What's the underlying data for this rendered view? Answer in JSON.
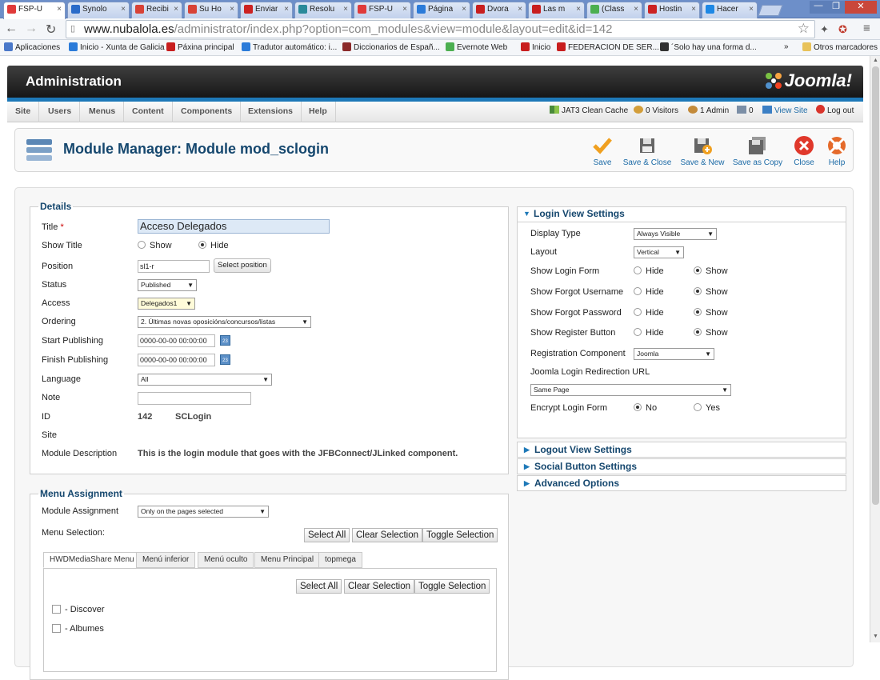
{
  "browser": {
    "tabs": [
      {
        "label": "FSP-U",
        "color": "#e03a3a"
      },
      {
        "label": "Synolo",
        "color": "#2a6bc9"
      },
      {
        "label": "Recibi",
        "color": "#d84236"
      },
      {
        "label": "Su Ho",
        "color": "#d84236"
      },
      {
        "label": "Enviar",
        "color": "#cc2222"
      },
      {
        "label": "Resolu",
        "color": "#2a8a9a"
      },
      {
        "label": "FSP-U",
        "color": "#e03a3a"
      },
      {
        "label": "Página",
        "color": "#2b7bd9"
      },
      {
        "label": "Dvora",
        "color": "#c81e1e"
      },
      {
        "label": "Las m",
        "color": "#c81e1e"
      },
      {
        "label": "(Class",
        "color": "#4caf50"
      },
      {
        "label": "Hostin",
        "color": "#cc2222"
      },
      {
        "label": "Hacer",
        "color": "#1e88e5"
      }
    ],
    "url_host": "www.nubalola.es",
    "url_path": "/administrator/index.php?option=com_modules&view=module&layout=edit&id=142",
    "bookmarks": [
      {
        "label": "Aplicaciones",
        "color": "#4a78c9"
      },
      {
        "label": "Inicio - Xunta de Galicia",
        "color": "#2b7bd9"
      },
      {
        "label": "Páxina principal",
        "color": "#c81e1e"
      },
      {
        "label": "Tradutor automático: i...",
        "color": "#2b7bd9"
      },
      {
        "label": "Diccionarios de Españ...",
        "color": "#8b2a2a"
      },
      {
        "label": "Evernote Web",
        "color": "#4caf50"
      },
      {
        "label": "Inicio",
        "color": "#c81e1e"
      },
      {
        "label": "FEDERACION DE SER...",
        "color": "#c81e1e"
      },
      {
        "label": "´Solo hay una forma d...",
        "color": "#333333"
      },
      {
        "label": "»",
        "color": "#00000000"
      },
      {
        "label": "Otros marcadores",
        "color": "#e8c25a"
      }
    ]
  },
  "header": {
    "title": "Administration",
    "logo_text": "Joomla!"
  },
  "menu": [
    "Site",
    "Users",
    "Menus",
    "Content",
    "Components",
    "Extensions",
    "Help"
  ],
  "status": {
    "cache": "JAT3 Clean Cache",
    "visitors": "0 Visitors",
    "admin": "1 Admin",
    "messages": "0",
    "view_site": "View Site",
    "logout": "Log out"
  },
  "toolbar": {
    "page_title": "Module Manager: Module mod_sclogin",
    "save": "Save",
    "save_close": "Save & Close",
    "save_new": "Save & New",
    "save_copy": "Save as Copy",
    "close": "Close",
    "help": "Help"
  },
  "details": {
    "legend": "Details",
    "title_label": "Title",
    "title_value": "Acceso Delegados",
    "show_title_label": "Show Title",
    "show": "Show",
    "hide": "Hide",
    "position_label": "Position",
    "position_value": "sl1-r",
    "select_position": "Select position",
    "status_label": "Status",
    "status_value": "Published",
    "access_label": "Access",
    "access_value": "Delegados1",
    "ordering_label": "Ordering",
    "ordering_value": "2. Últimas novas oposicións/concursos/listas",
    "start_label": "Start Publishing",
    "start_value": "0000-00-00 00:00:00",
    "finish_label": "Finish Publishing",
    "finish_value": "0000-00-00 00:00:00",
    "calendar_day": "23",
    "language_label": "Language",
    "language_value": "All",
    "note_label": "Note",
    "note_value": "",
    "id_label": "ID",
    "id_value": "142",
    "id_name": "SCLogin",
    "site_label": "Site",
    "desc_label": "Module Description",
    "desc_value": "This is the login module that goes with the JFBConnect/JLinked component."
  },
  "menu_assignment": {
    "legend": "Menu Assignment",
    "assign_label": "Module Assignment",
    "assign_value": "Only on the pages selected",
    "selection_label": "Menu Selection:",
    "select_all": "Select All",
    "clear_selection": "Clear Selection",
    "toggle_selection": "Toggle Selection",
    "tabs": [
      "HWDMediaShare Menu",
      "Menú inferior",
      "Menú oculto",
      "Menu Principal",
      "topmega"
    ],
    "items": [
      "- Discover",
      "- Albumes"
    ]
  },
  "login_view": {
    "title": "Login View Settings",
    "display_type_label": "Display Type",
    "display_type_value": "Always Visible",
    "layout_label": "Layout",
    "layout_value": "Vertical",
    "rows": [
      {
        "label": "Show Login Form",
        "no": "Hide",
        "yes": "Show"
      },
      {
        "label": "Show Forgot Username",
        "no": "Hide",
        "yes": "Show"
      },
      {
        "label": "Show Forgot Password",
        "no": "Hide",
        "yes": "Show"
      },
      {
        "label": "Show Register Button",
        "no": "Hide",
        "yes": "Show"
      }
    ],
    "reg_comp_label": "Registration Component",
    "reg_comp_value": "Joomla",
    "redirect_label": "Joomla Login Redirection URL",
    "redirect_value": "Same Page",
    "encrypt_label": "Encrypt Login Form",
    "encrypt_no": "No",
    "encrypt_yes": "Yes"
  },
  "panels": [
    "Logout View Settings",
    "Social Button Settings",
    "Advanced Options"
  ]
}
